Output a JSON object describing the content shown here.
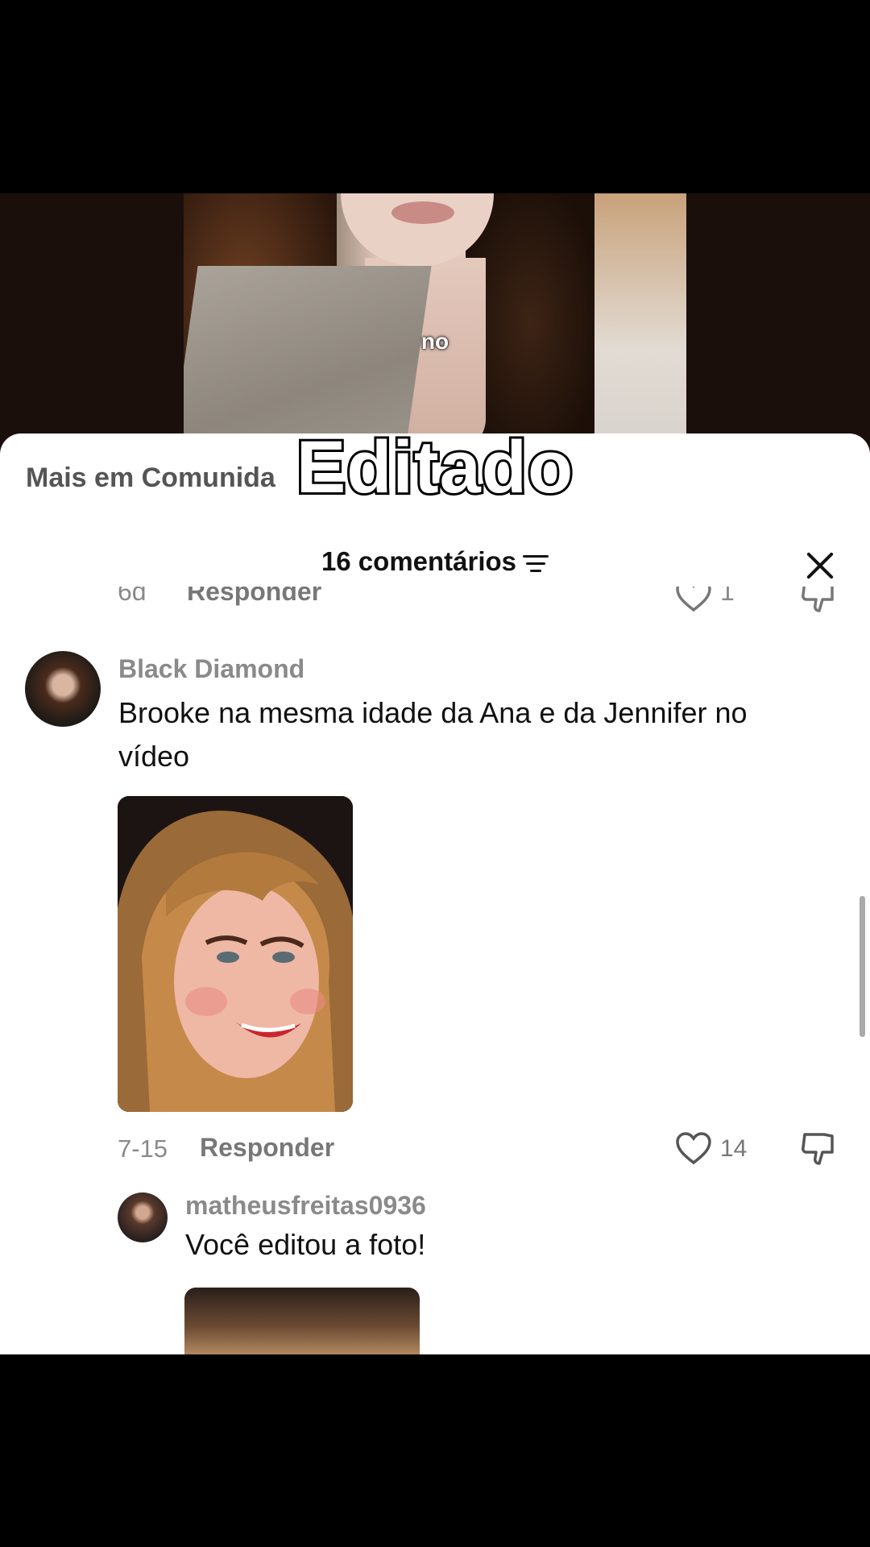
{
  "video": {
    "caption": "no"
  },
  "overlay": {
    "title": "Editado"
  },
  "sheet": {
    "community_text": "Mais em Comunida",
    "header": {
      "count_label": "16 comentários"
    },
    "partial_row": {
      "time": "6d",
      "reply_label": "Responder",
      "likes": "1"
    },
    "comments": [
      {
        "username": "Black Diamond",
        "text_line1": "Brooke na mesma idade da Ana e da Jennifer no",
        "text_line2": "vídeo",
        "date": "7-15",
        "reply_label": "Responder",
        "likes": "14"
      },
      {
        "username": "matheusfreitas0936",
        "text": "Você editou a foto!"
      }
    ]
  },
  "icons": {
    "filter": "filter-icon",
    "close": "close-icon",
    "like": "heart-icon",
    "dislike": "thumbs-down-icon"
  },
  "colors": {
    "link": "#1d6fe0",
    "muted": "#8a8a8a",
    "text": "#111111"
  }
}
